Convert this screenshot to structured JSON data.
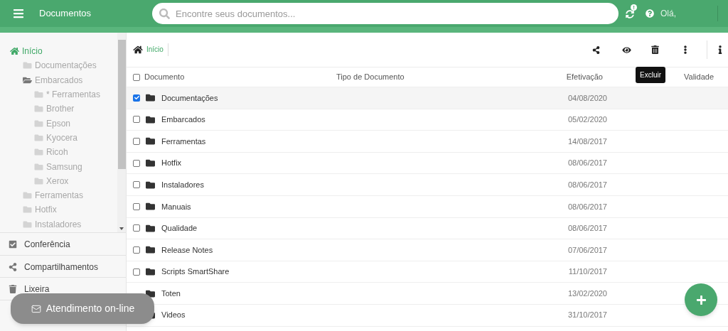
{
  "header": {
    "title": "Documentos",
    "search": {
      "placeholder": "Encontre seus documentos..."
    },
    "sync_badge": "!",
    "greeting": "Olá,"
  },
  "tree": [
    {
      "label": "Início",
      "kind": "home",
      "selected": true,
      "children": [
        {
          "label": "Documentações",
          "kind": "folder",
          "selected": false,
          "expanded": false
        },
        {
          "label": "Embarcados",
          "kind": "folder",
          "selected": false,
          "expanded": true,
          "children": [
            {
              "label": "* Ferramentas",
              "kind": "folder",
              "selected": false,
              "expanded": false
            },
            {
              "label": "Brother",
              "kind": "folder",
              "selected": false,
              "expanded": false
            },
            {
              "label": "Epson",
              "kind": "folder",
              "selected": false,
              "expanded": false
            },
            {
              "label": "Kyocera",
              "kind": "folder",
              "selected": false,
              "expanded": false
            },
            {
              "label": "Ricoh",
              "kind": "folder",
              "selected": false,
              "expanded": false
            },
            {
              "label": "Samsung",
              "kind": "folder",
              "selected": false,
              "expanded": false
            },
            {
              "label": "Xerox",
              "kind": "folder",
              "selected": false,
              "expanded": false
            }
          ]
        },
        {
          "label": "Ferramentas",
          "kind": "folder",
          "selected": false,
          "expanded": false
        },
        {
          "label": "Hotfix",
          "kind": "folder",
          "selected": false,
          "expanded": false
        },
        {
          "label": "Instaladores",
          "kind": "folder",
          "selected": false,
          "expanded": false
        }
      ]
    }
  ],
  "sidebar_links": [
    {
      "label": "Conferência",
      "kind": "check"
    },
    {
      "label": "Compartilhamentos",
      "kind": "share"
    },
    {
      "label": "Lixeira",
      "kind": "trash"
    }
  ],
  "chat_button": "Atendimento on-line",
  "breadcrumb": [
    "Início"
  ],
  "tooltip": "Excluir",
  "table": {
    "select_all_checked": false,
    "columns": [
      "Documento",
      "Tipo de Documento",
      "Efetivação",
      "Validade"
    ],
    "rows": [
      {
        "name": "Documentações",
        "date": "04/08/2020",
        "selected": true
      },
      {
        "name": "Embarcados",
        "date": "05/02/2020",
        "selected": false
      },
      {
        "name": "Ferramentas",
        "date": "14/08/2017",
        "selected": false
      },
      {
        "name": "Hotfix",
        "date": "08/06/2017",
        "selected": false
      },
      {
        "name": "Instaladores",
        "date": "08/06/2017",
        "selected": false
      },
      {
        "name": "Manuais",
        "date": "08/06/2017",
        "selected": false
      },
      {
        "name": "Qualidade",
        "date": "08/06/2017",
        "selected": false
      },
      {
        "name": "Release Notes",
        "date": "07/06/2017",
        "selected": false
      },
      {
        "name": "Scripts SmartShare",
        "date": "11/10/2017",
        "selected": false
      },
      {
        "name": "Toten",
        "date": "13/02/2020"
      },
      {
        "name": "Videos",
        "date": "31/10/2017"
      }
    ]
  }
}
